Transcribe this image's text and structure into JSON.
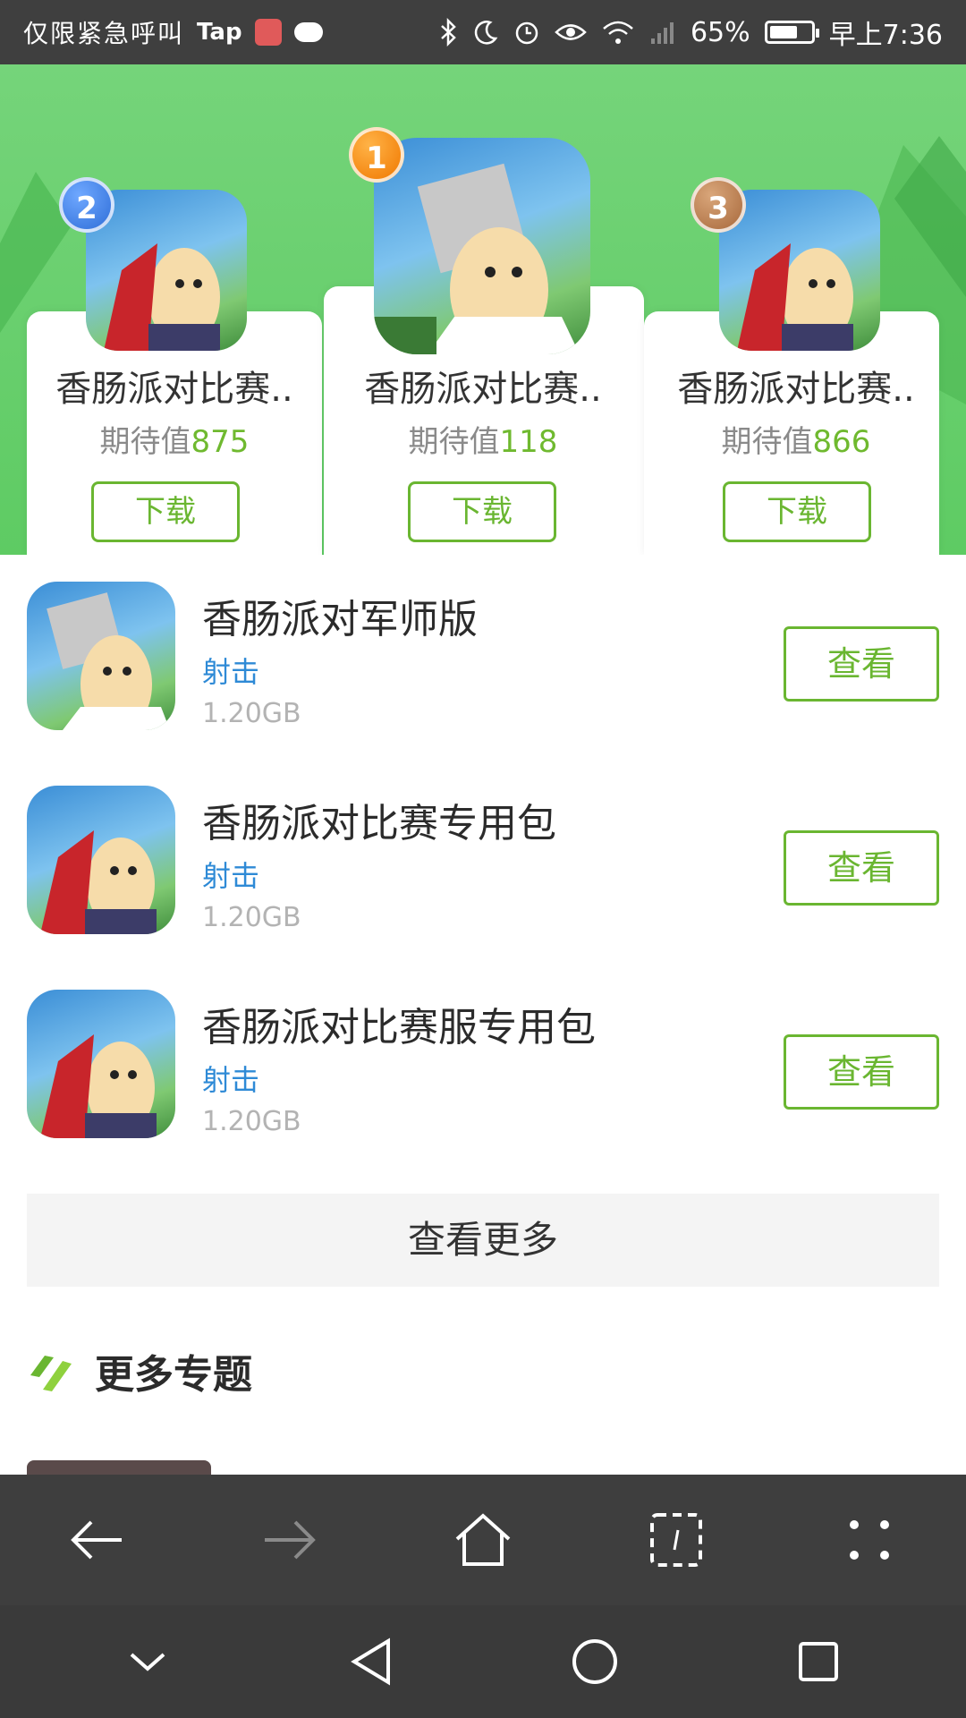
{
  "status_bar": {
    "left_text": "仅限紧急呼叫",
    "tap_label": "Tap",
    "battery": "65%",
    "time": "早上7:36",
    "icons": [
      "bluetooth-icon",
      "moon-icon",
      "alarm-icon",
      "eye-icon",
      "wifi-icon",
      "signal-icon",
      "battery-icon"
    ]
  },
  "ranking": [
    {
      "rank": "2",
      "title": "香肠派对比赛..",
      "expect_label": "期待值",
      "expect_value": "875",
      "button": "下载"
    },
    {
      "rank": "1",
      "title": "香肠派对比赛..",
      "expect_label": "期待值",
      "expect_value": "118",
      "button": "下载"
    },
    {
      "rank": "3",
      "title": "香肠派对比赛..",
      "expect_label": "期待值",
      "expect_value": "866",
      "button": "下载"
    }
  ],
  "list": [
    {
      "title": "香肠派对军师版",
      "category": "射击",
      "size": "1.20GB",
      "button": "查看"
    },
    {
      "title": "香肠派对比赛专用包",
      "category": "射击",
      "size": "1.20GB",
      "button": "查看"
    },
    {
      "title": "香肠派对比赛服专用包",
      "category": "射击",
      "size": "1.20GB",
      "button": "查看"
    }
  ],
  "more_button": "查看更多",
  "section_title": "更多专题",
  "colors": {
    "accent": "#6ab631",
    "banner": "#5ecb63",
    "category": "#2e8ad6"
  },
  "toolbar_icons": [
    "back-arrow-icon",
    "forward-arrow-icon",
    "home-icon",
    "tabs-icon",
    "menu-dots-icon"
  ],
  "nav_icons": [
    "collapse-chevron-icon",
    "nav-back-icon",
    "nav-home-icon",
    "nav-recent-icon"
  ]
}
